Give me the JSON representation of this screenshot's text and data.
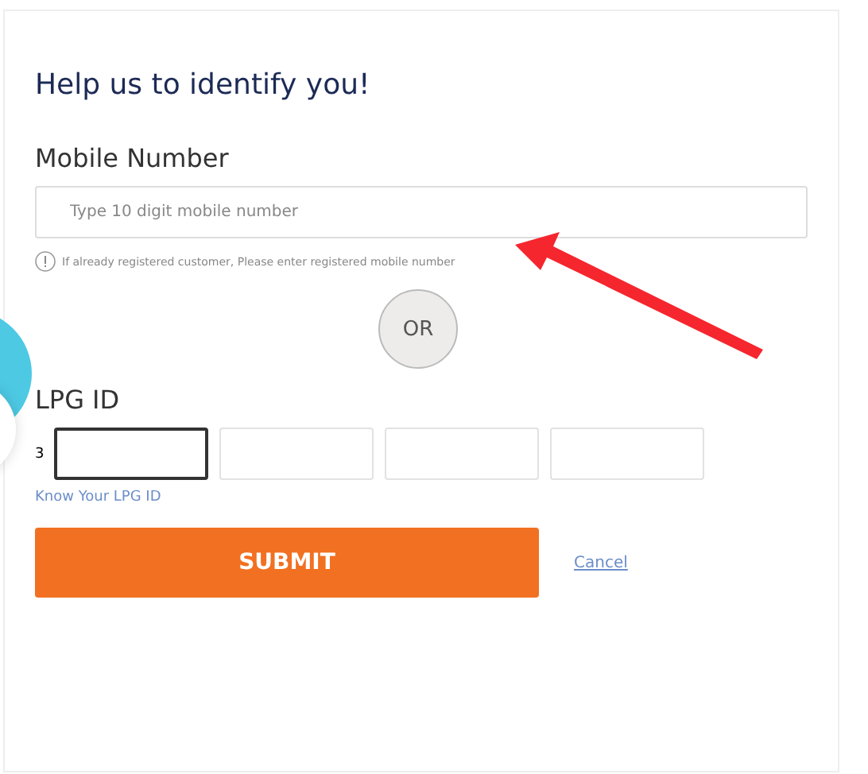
{
  "heading": "Help us to identify you!",
  "mobile": {
    "label": "Mobile Number",
    "placeholder": "Type 10 digit mobile number",
    "hint": "If already registered customer, Please enter registered mobile number"
  },
  "separator": "OR",
  "lpg": {
    "label": "LPG ID",
    "prefix": "3",
    "fields": [
      {
        "focused": true
      },
      {
        "focused": false
      },
      {
        "focused": false
      },
      {
        "focused": false
      }
    ],
    "link": "Know Your LPG ID"
  },
  "buttons": {
    "submit": "SUBMIT",
    "cancel": "Cancel"
  }
}
